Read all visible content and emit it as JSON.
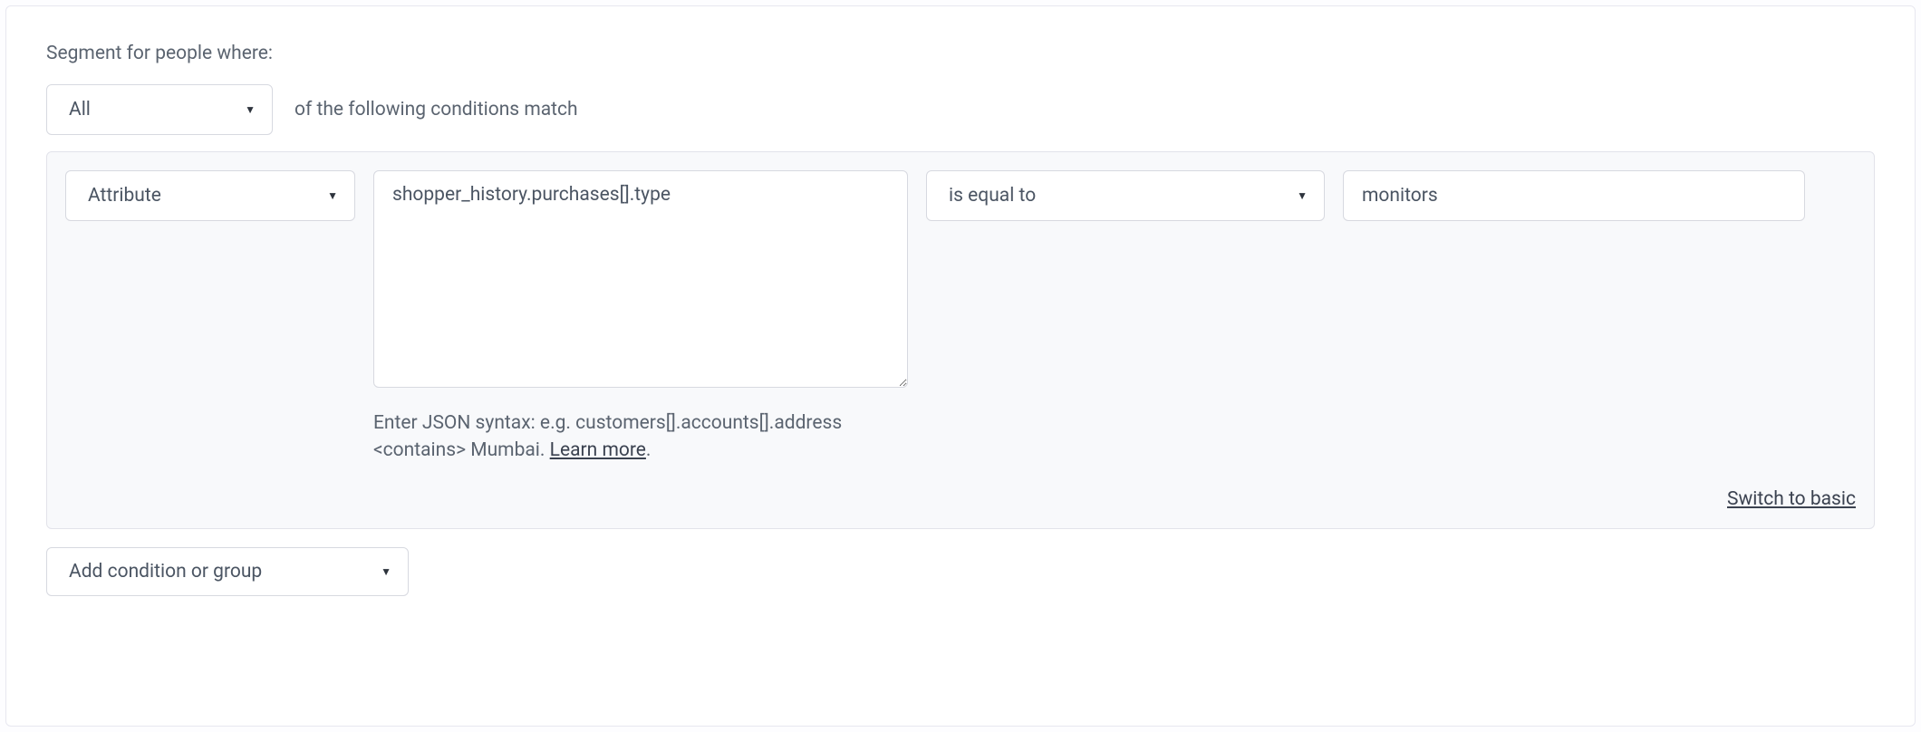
{
  "header": {
    "segment_label": "Segment for people where:"
  },
  "match": {
    "mode_label": "All",
    "suffix_text": "of the following conditions match"
  },
  "condition": {
    "type_label": "Attribute",
    "path_value": "shopper_history.purchases[].type",
    "help_prefix": "Enter JSON syntax: e.g. customers[].accounts[].address <contains> Mumbai. ",
    "learn_more_label": "Learn more",
    "help_suffix": ".",
    "operator_label": "is equal to",
    "value": "monitors"
  },
  "switch_link_label": "Switch to basic",
  "add_condition_label": "Add condition or group"
}
